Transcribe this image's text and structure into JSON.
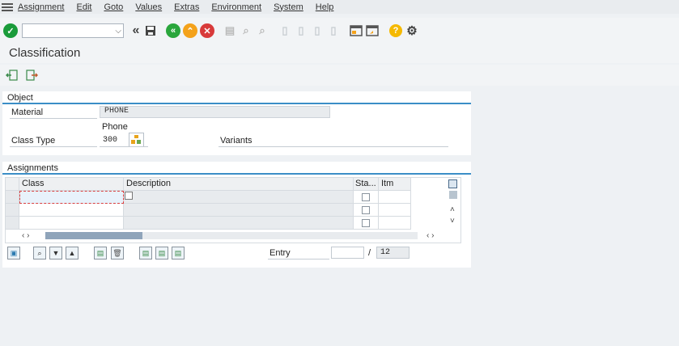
{
  "menu": {
    "items": [
      "Assignment",
      "Edit",
      "Goto",
      "Values",
      "Extras",
      "Environment",
      "System",
      "Help"
    ]
  },
  "toolbar": {
    "command_value": "",
    "icons": [
      "check-icon",
      "back-icon",
      "save-icon",
      "exit-icon",
      "up-icon",
      "cancel-icon",
      "print-icon",
      "find-icon",
      "find-next-icon",
      "first-page-icon",
      "previous-page-icon",
      "next-page-icon",
      "last-page-icon",
      "new-session-icon",
      "shortcut-icon",
      "help-icon",
      "settings-icon"
    ]
  },
  "page": {
    "title": "Classification"
  },
  "object_group": {
    "title": "Object",
    "material_label": "Material",
    "material_value": "PHONE",
    "material_description": "Phone",
    "class_type_label": "Class Type",
    "class_type_value": "300",
    "variants_label": "Variants"
  },
  "assignments": {
    "title": "Assignments",
    "columns": {
      "class": "Class",
      "description": "Description",
      "status": "Sta...",
      "item": "Itm"
    },
    "entry_label": "Entry",
    "entry_value": "",
    "entry_separator": "/",
    "entry_total": "12"
  },
  "colors": {
    "accent": "#3b8ec7",
    "confirm": "#1a9b3a",
    "nav_green": "#2aa63c",
    "nav_orange": "#f4a21b",
    "cancel_red": "#d83a3a",
    "help_yellow": "#f5b900"
  }
}
